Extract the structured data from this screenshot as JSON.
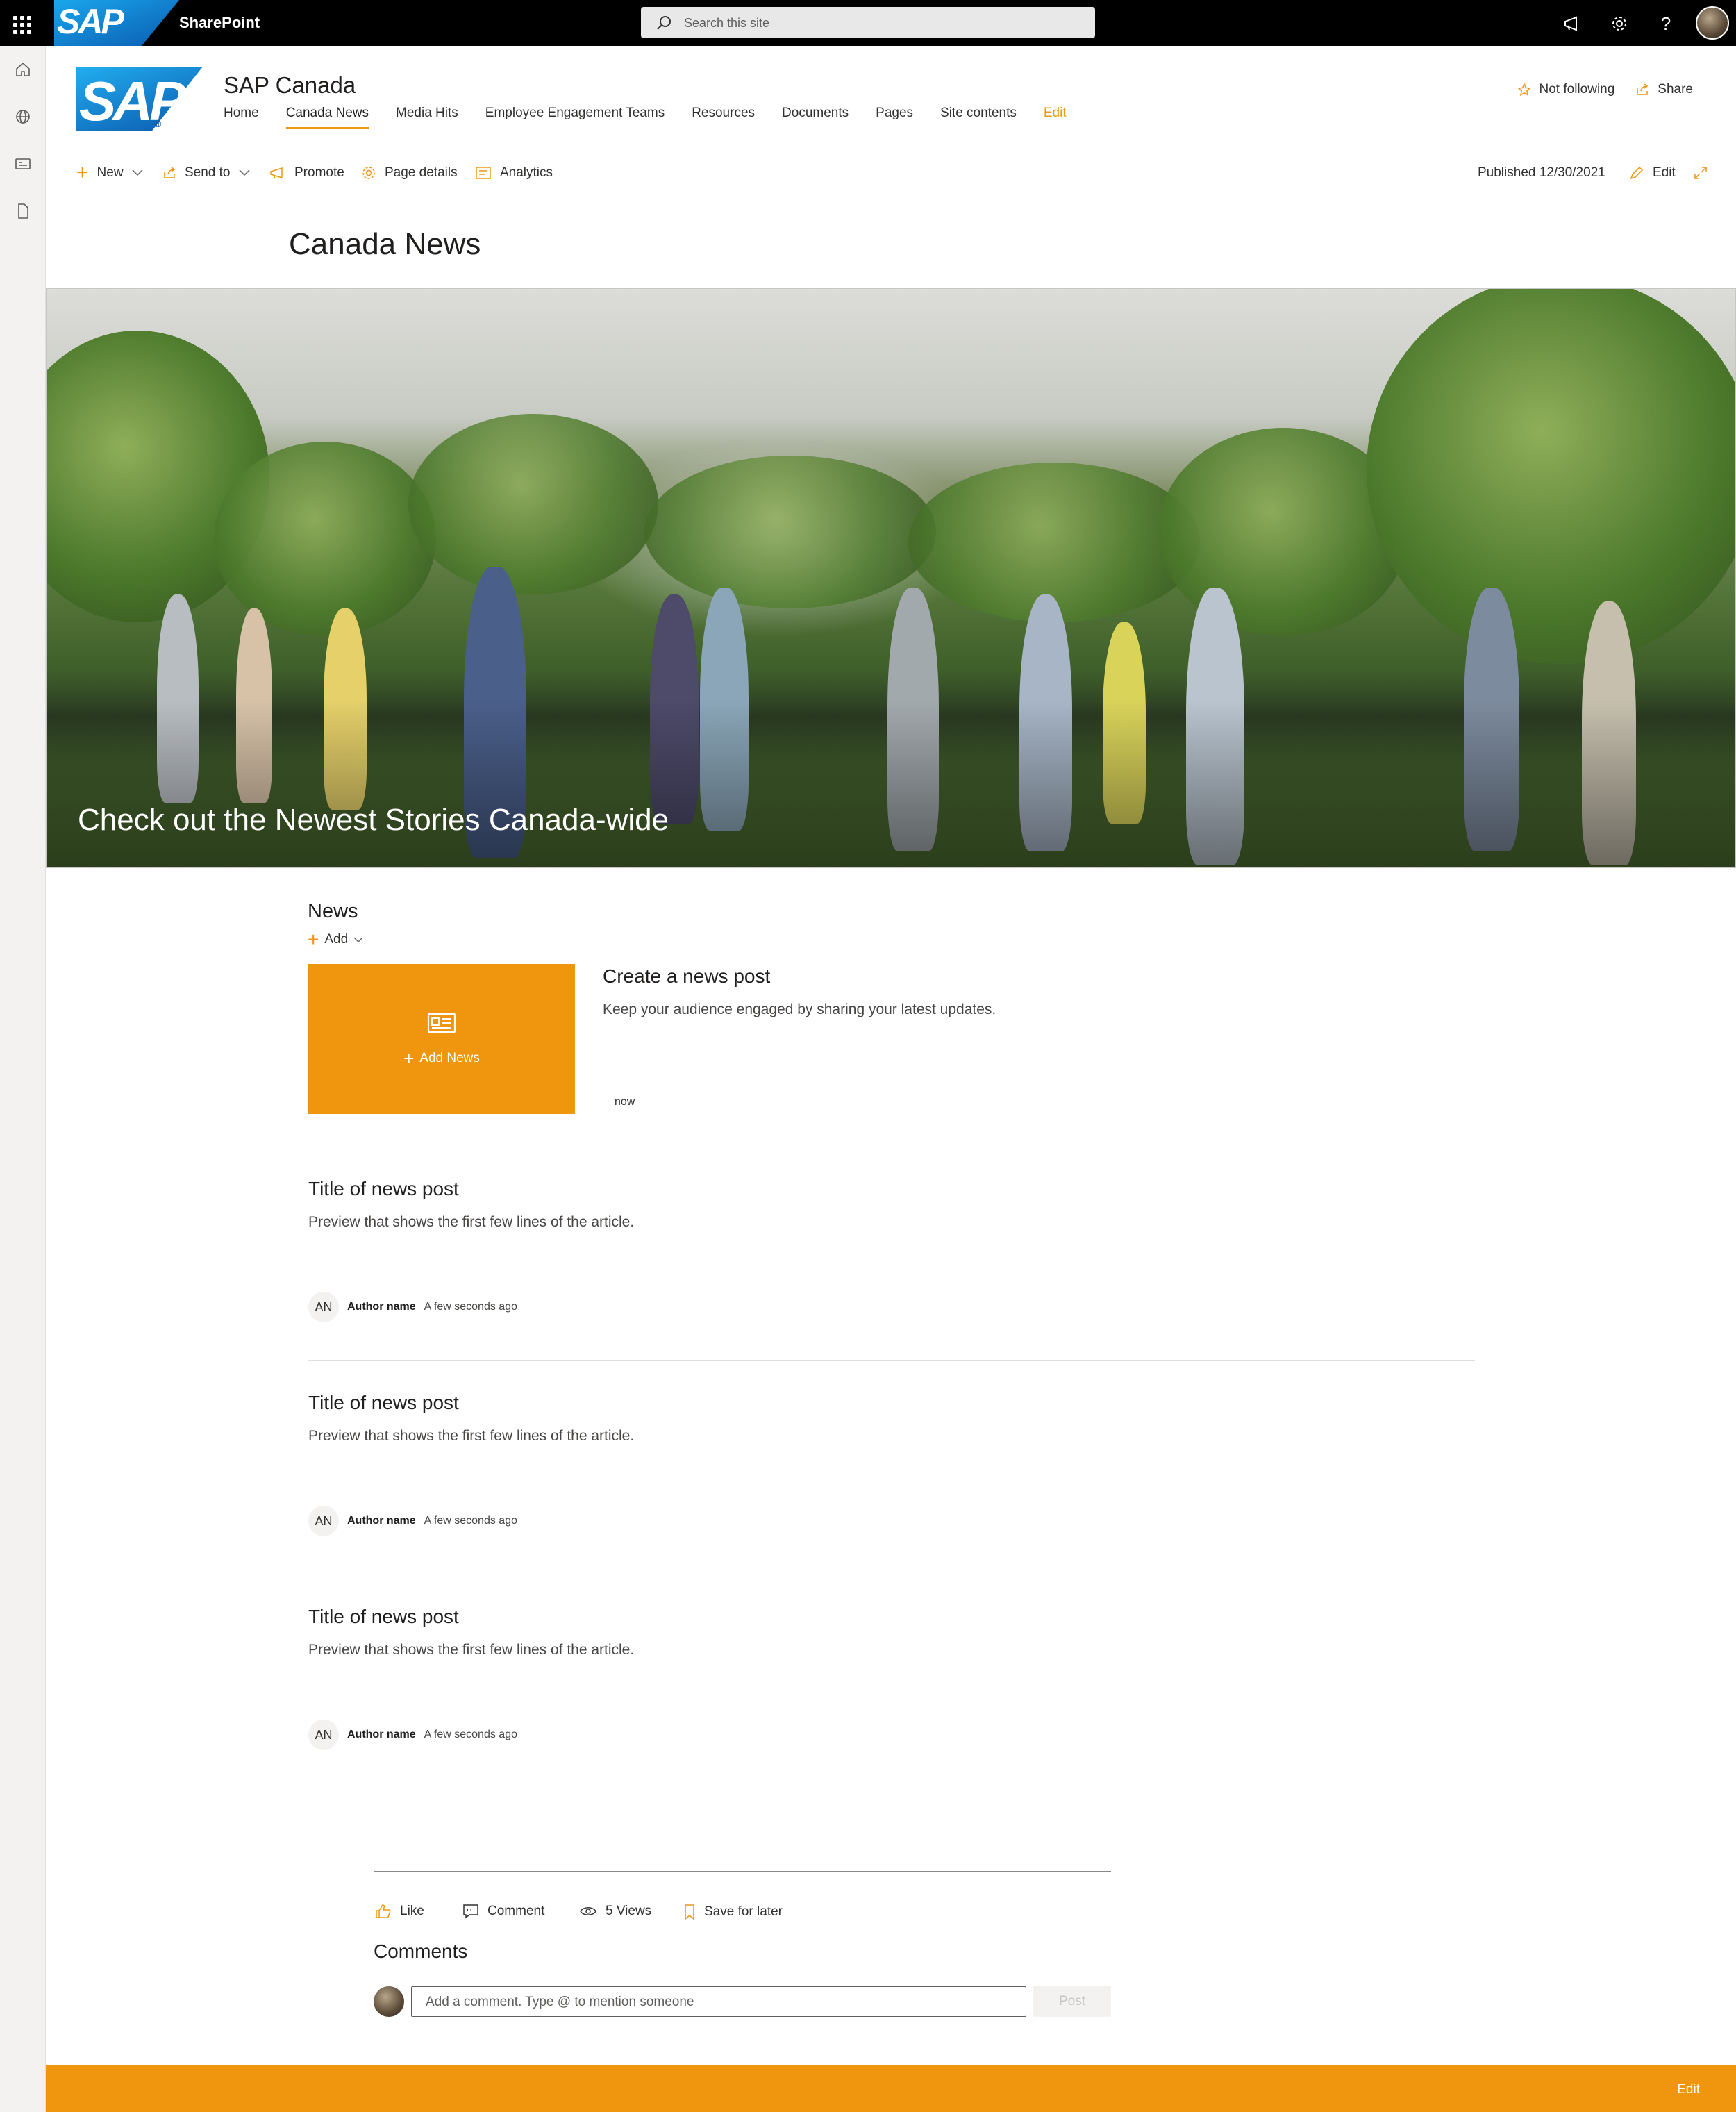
{
  "suite": {
    "brand": "SAP",
    "app_name": "SharePoint",
    "search_placeholder": "Search this site"
  },
  "site": {
    "logo_text": "SAP",
    "title": "SAP Canada",
    "nav": [
      "Home",
      "Canada News",
      "Media Hits",
      "Employee Engagement Teams",
      "Resources",
      "Documents",
      "Pages",
      "Site contents",
      "Edit"
    ],
    "active_nav": "Canada News",
    "follow_label": "Not following",
    "share_label": "Share"
  },
  "commandbar": {
    "new_label": "New",
    "send_to_label": "Send to",
    "promote_label": "Promote",
    "page_details_label": "Page details",
    "analytics_label": "Analytics",
    "published_label": "Published 12/30/2021",
    "edit_label": "Edit"
  },
  "page": {
    "title": "Canada News"
  },
  "hero": {
    "title": "Check out the Newest Stories Canada-wide"
  },
  "news": {
    "heading": "News",
    "add_label": "Add",
    "tile_label": "Add News",
    "create_title": "Create a news post",
    "create_desc": "Keep your audience engaged by sharing your latest updates.",
    "create_time": "now",
    "posts": [
      {
        "title": "Title of news post",
        "preview": "Preview that shows the first few lines of the article.",
        "initials": "AN",
        "author": "Author name",
        "time": "A few seconds ago"
      },
      {
        "title": "Title of news post",
        "preview": "Preview that shows the first few lines of the article.",
        "initials": "AN",
        "author": "Author name",
        "time": "A few seconds ago"
      },
      {
        "title": "Title of news post",
        "preview": "Preview that shows the first few lines of the article.",
        "initials": "AN",
        "author": "Author name",
        "time": "A few seconds ago"
      }
    ]
  },
  "social": {
    "like_label": "Like",
    "comment_label": "Comment",
    "views_label": "5 Views",
    "save_label": "Save for later",
    "comments_heading": "Comments",
    "comment_placeholder": "Add a comment. Type @ to mention someone",
    "post_label": "Post"
  },
  "footer": {
    "edit_label": "Edit"
  },
  "colors": {
    "accent": "#f0960e",
    "suitebar": "#000000"
  }
}
